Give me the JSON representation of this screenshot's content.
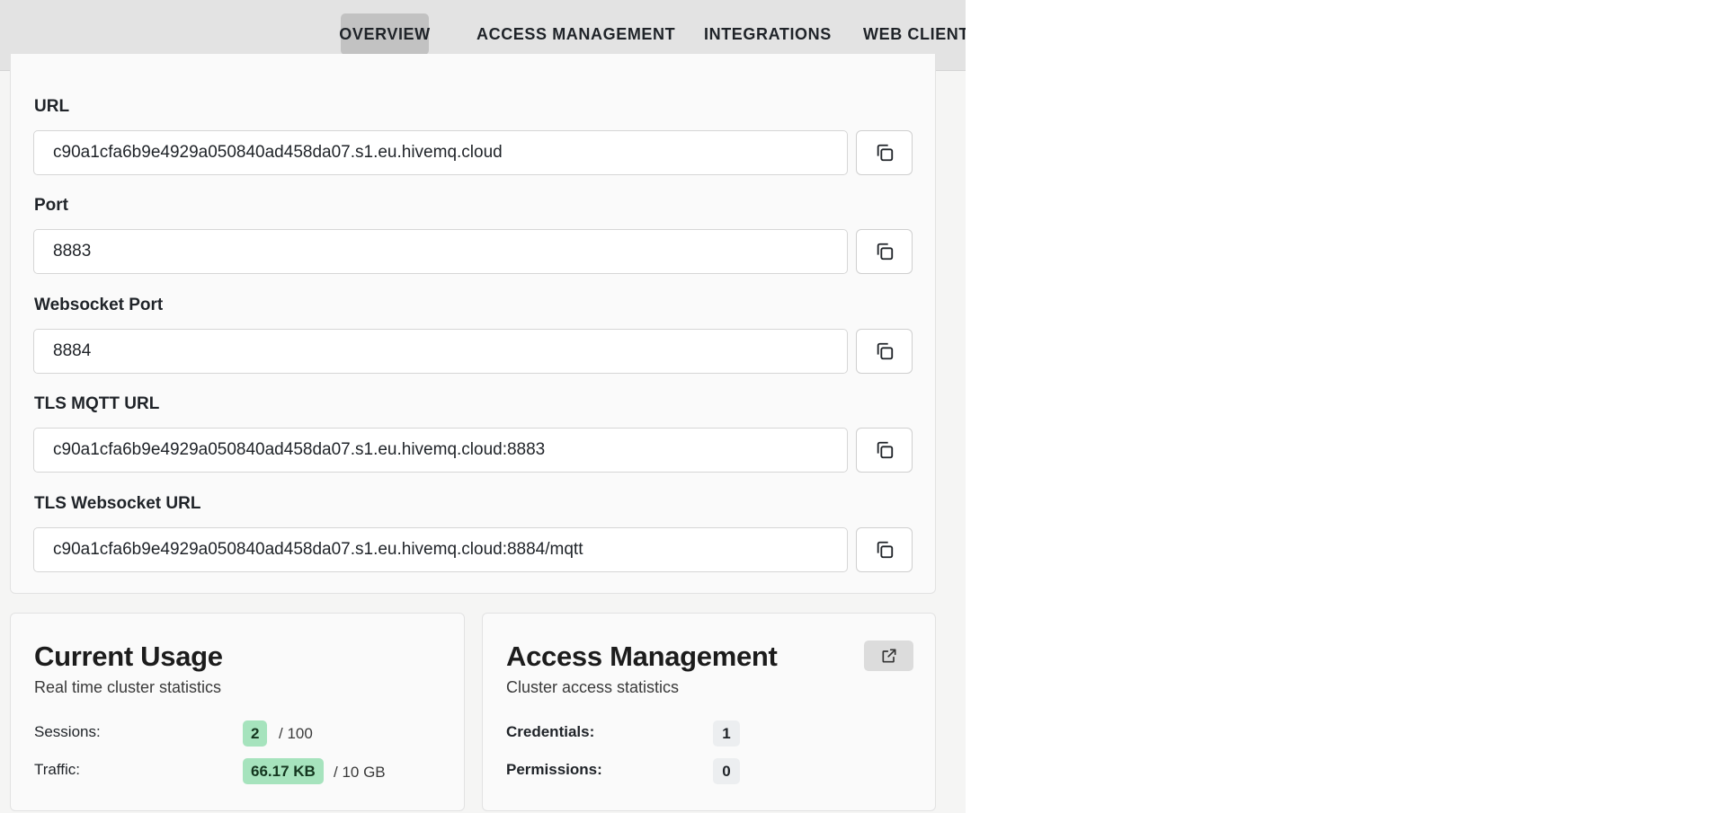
{
  "nav": {
    "tabs": [
      {
        "label": "OVERVIEW",
        "active": true
      },
      {
        "label": "ACCESS MANAGEMENT",
        "active": false
      },
      {
        "label": "INTEGRATIONS",
        "active": false
      },
      {
        "label": "WEB CLIENT",
        "active": false
      }
    ]
  },
  "connection": {
    "fields": [
      {
        "label": "URL",
        "value": "c90a1cfa6b9e4929a050840ad458da07.s1.eu.hivemq.cloud",
        "copy_icon": "copy-icon"
      },
      {
        "label": "Port",
        "value": "8883",
        "copy_icon": "copy-icon"
      },
      {
        "label": "Websocket Port",
        "value": "8884",
        "copy_icon": "copy-icon"
      },
      {
        "label": "TLS MQTT URL",
        "value": "c90a1cfa6b9e4929a050840ad458da07.s1.eu.hivemq.cloud:8883",
        "copy_icon": "copy-icon"
      },
      {
        "label": "TLS Websocket URL",
        "value": "c90a1cfa6b9e4929a050840ad458da07.s1.eu.hivemq.cloud:8884/mqtt",
        "copy_icon": "copy-icon"
      }
    ]
  },
  "usage": {
    "title": "Current Usage",
    "subtitle": "Real time cluster statistics",
    "sessions_label": "Sessions:",
    "sessions_value": "2",
    "sessions_limit": "/ 100",
    "traffic_label": "Traffic:",
    "traffic_value": "66.17 KB",
    "traffic_limit": "/ 10 GB"
  },
  "access": {
    "title": "Access Management",
    "subtitle": "Cluster access statistics",
    "external_icon": "external-link-icon",
    "credentials_label": "Credentials:",
    "credentials_value": "1",
    "permissions_label": "Permissions:",
    "permissions_value": "0"
  },
  "colors": {
    "nav_bg": "#e3e3e3",
    "active_tab_bg": "#c2c2c2",
    "green_badge": "#a6e3bd",
    "gray_badge": "#eceef0"
  }
}
